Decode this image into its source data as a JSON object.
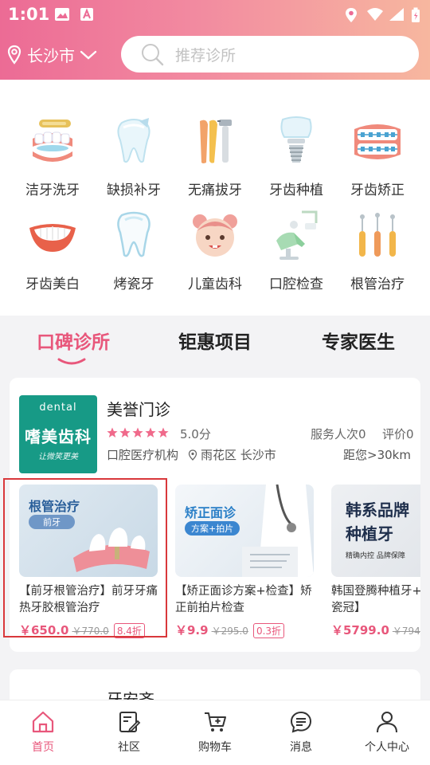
{
  "status_bar": {
    "time": "1:01"
  },
  "header": {
    "city": "长沙市",
    "search_placeholder": "推荐诊所"
  },
  "categories": [
    {
      "label": "洁牙洗牙",
      "icon": "teeth-cleaning-icon"
    },
    {
      "label": "缺损补牙",
      "icon": "tooth-filling-icon"
    },
    {
      "label": "无痛拔牙",
      "icon": "tooth-extraction-icon"
    },
    {
      "label": "牙齿种植",
      "icon": "dental-implant-icon"
    },
    {
      "label": "牙齿矫正",
      "icon": "braces-icon"
    },
    {
      "label": "牙齿美白",
      "icon": "teeth-whitening-icon"
    },
    {
      "label": "烤瓷牙",
      "icon": "porcelain-tooth-icon"
    },
    {
      "label": "儿童齿科",
      "icon": "child-dentistry-icon"
    },
    {
      "label": "口腔检查",
      "icon": "dental-checkup-icon"
    },
    {
      "label": "根管治疗",
      "icon": "root-canal-icon"
    }
  ],
  "tabs": [
    {
      "label": "口碑诊所",
      "active": true
    },
    {
      "label": "钜惠项目",
      "active": false
    },
    {
      "label": "专家医生",
      "active": false
    }
  ],
  "clinic": {
    "logo_top": "dental",
    "logo_name": "嗜美齿科",
    "logo_sig": "让微笑更美",
    "name": "美誉门诊",
    "rating": 5,
    "score": "5.0分",
    "served": "服务人次0",
    "reviews": "评价0",
    "org_type": "口腔医疗机构",
    "address": "雨花区 长沙市",
    "distance": "距您>30km",
    "services": [
      {
        "image_title": "根管治疗",
        "image_tag": "前牙",
        "title": "【前牙根管治疗】前牙牙痛热牙胶根管治疗",
        "price": "￥650.0",
        "old_price": "￥770.0",
        "discount": "8.4折"
      },
      {
        "image_title": "矫正面诊",
        "image_tag": "方案+拍片",
        "title": "【矫正面诊方案+检查】矫正前拍片检查",
        "price": "￥9.9",
        "old_price": "￥295.0",
        "discount": "0.3折"
      },
      {
        "image_title": "韩系品牌",
        "image_title2": "种植牙",
        "image_tag": "精确内控 品牌保障",
        "title": "韩国登腾种植牙+基台+全瓷冠】",
        "price": "￥5799.0",
        "old_price": "￥794",
        "discount": ""
      }
    ]
  },
  "clinic2": {
    "name": "牙安齐"
  },
  "bottom_nav": [
    {
      "label": "首页",
      "icon": "home-icon",
      "active": true
    },
    {
      "label": "社区",
      "icon": "community-icon",
      "active": false
    },
    {
      "label": "购物车",
      "icon": "cart-icon",
      "active": false
    },
    {
      "label": "消息",
      "icon": "message-icon",
      "active": false
    },
    {
      "label": "个人中心",
      "icon": "profile-icon",
      "active": false
    }
  ],
  "colors": {
    "accent": "#e8577b",
    "header_start": "#ec6b95",
    "header_end": "#f7b79f",
    "logo_bg": "#179a86"
  }
}
